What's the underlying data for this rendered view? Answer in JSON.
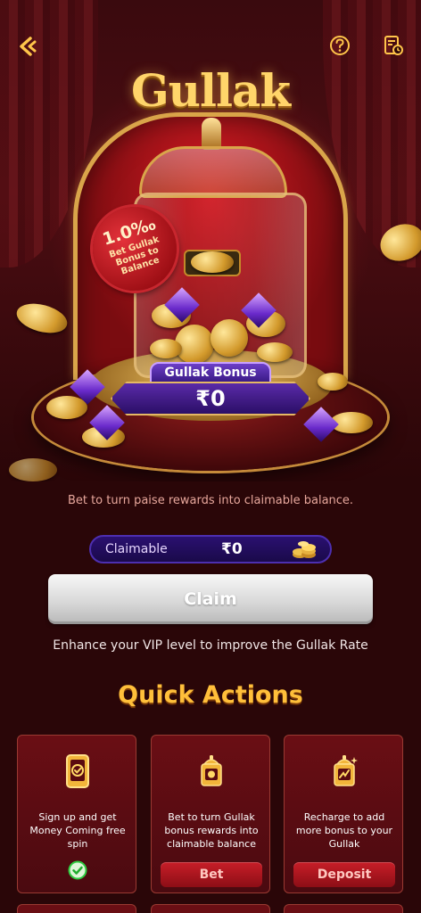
{
  "header": {
    "back_icon": "back-chevron-icon",
    "help_icon": "question-circle-icon",
    "rules_icon": "document-clock-icon"
  },
  "hero": {
    "logo_text": "Gullak",
    "rate_tag": {
      "value": "1.0‰",
      "label": "Bet Gullak Bonus to Balance"
    },
    "bonus": {
      "title": "Gullak Bonus",
      "amount": "₹0"
    }
  },
  "info_text": "Bet to turn paise rewards into claimable balance.",
  "claimable": {
    "label": "Claimable",
    "amount": "₹0",
    "icon": "coin-stack-icon"
  },
  "claim_button": "Claim",
  "vip_text": "Enhance your VIP level to improve the Gullak Rate",
  "quick_actions": {
    "title": "Quick Actions",
    "cards": [
      {
        "icon": "phone-check-icon",
        "text": "Sign up and get Money Coming free spin",
        "status_icon": "check-circle-icon"
      },
      {
        "icon": "gullak-jar-icon",
        "text": "Bet to turn Gullak bonus rewards into claimable balance",
        "button": "Bet"
      },
      {
        "icon": "recharge-jar-icon",
        "text": "Recharge to add more bonus to your Gullak",
        "button": "Deposit"
      }
    ]
  },
  "colors": {
    "background": "#2a0608",
    "accent_gold": "#ffbf3a",
    "button_red": "#c81e28",
    "claimable_bar": "#2a1070",
    "check_green": "#2ecc40"
  }
}
